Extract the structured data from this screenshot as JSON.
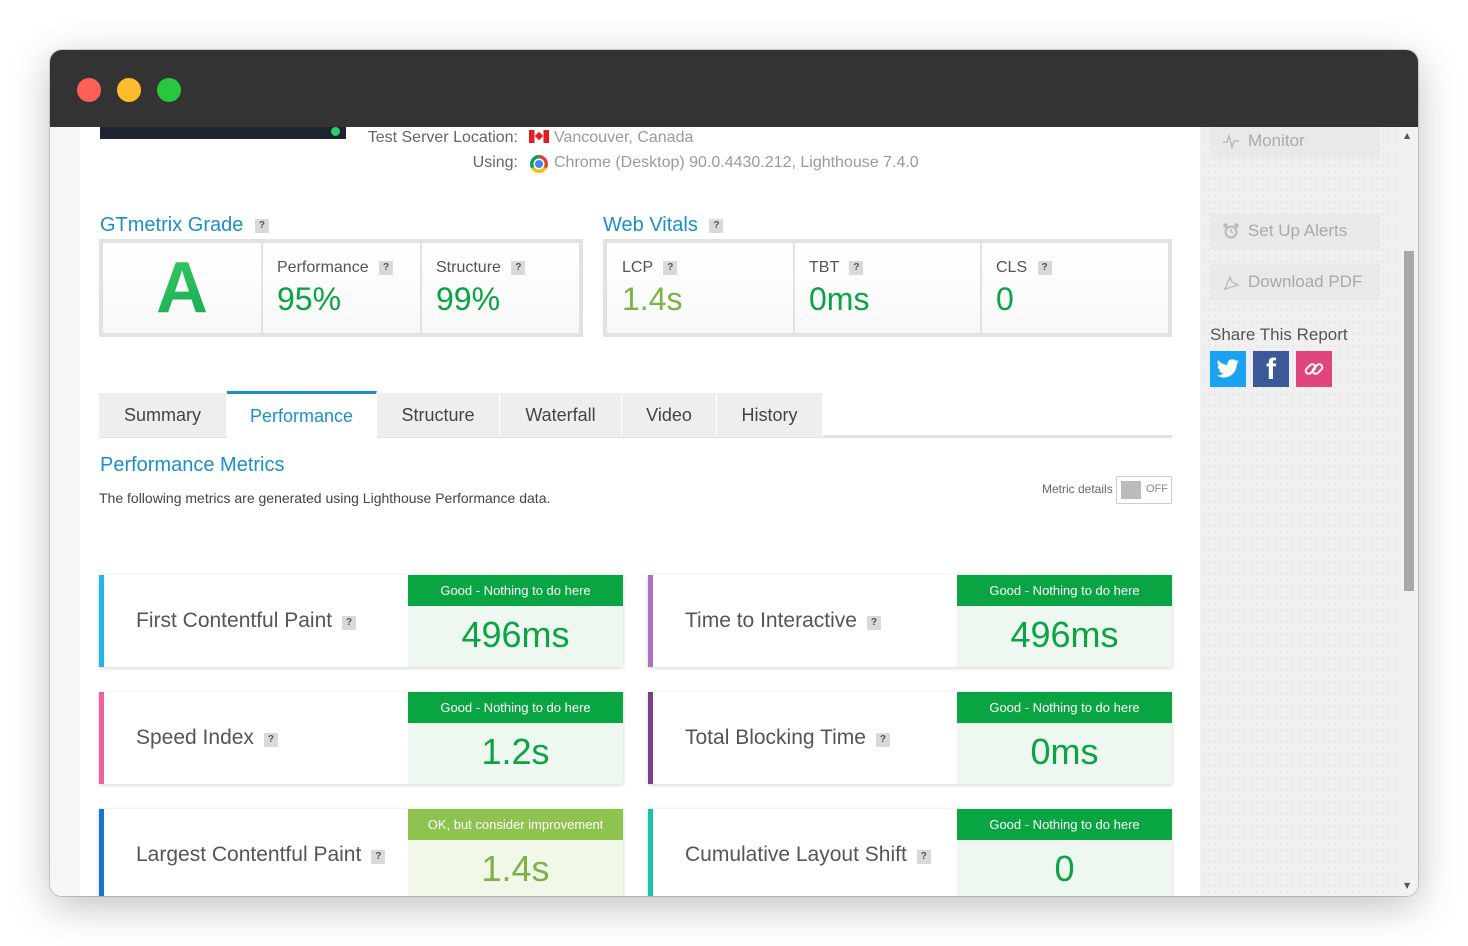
{
  "test_info": {
    "location_label": "Test Server Location:",
    "location_value": "Vancouver, Canada",
    "using_label": "Using:",
    "using_value": "Chrome (Desktop) 90.0.4430.212, Lighthouse 7.4.0"
  },
  "grade": {
    "title": "GTmetrix Grade",
    "letter": "A",
    "performance_label": "Performance",
    "performance_value": "95%",
    "structure_label": "Structure",
    "structure_value": "99%"
  },
  "web_vitals": {
    "title": "Web Vitals",
    "lcp_label": "LCP",
    "lcp_value": "1.4s",
    "tbt_label": "TBT",
    "tbt_value": "0ms",
    "cls_label": "CLS",
    "cls_value": "0"
  },
  "tabs": [
    {
      "label": "Summary"
    },
    {
      "label": "Performance"
    },
    {
      "label": "Structure"
    },
    {
      "label": "Waterfall"
    },
    {
      "label": "Video"
    },
    {
      "label": "History"
    }
  ],
  "active_tab": "Performance",
  "metrics_section": {
    "title": "Performance Metrics",
    "description": "The following metrics are generated using Lighthouse Performance data.",
    "toggle_label": "Metric details",
    "toggle_state": "OFF"
  },
  "metrics": [
    {
      "name": "First Contentful Paint",
      "status": "Good - Nothing to do here",
      "value": "496ms",
      "bar_color": "#1fb6ea"
    },
    {
      "name": "Time to Interactive",
      "status": "Good - Nothing to do here",
      "value": "496ms",
      "bar_color": "#b06fc7"
    },
    {
      "name": "Speed Index",
      "status": "Good - Nothing to do here",
      "value": "1.2s",
      "bar_color": "#ee5fa0"
    },
    {
      "name": "Total Blocking Time",
      "status": "Good - Nothing to do here",
      "value": "0ms",
      "bar_color": "#7a3f86"
    },
    {
      "name": "Largest Contentful Paint",
      "status": "OK, but consider improvement",
      "value": "1.4s",
      "bar_color": "#1476d2"
    },
    {
      "name": "Cumulative Layout Shift",
      "status": "Good - Nothing to do here",
      "value": "0",
      "bar_color": "#17c4a8"
    }
  ],
  "colors": {
    "good_badge": "#0aa543",
    "good_bg": "#eef8f1",
    "good_text": "#0aa543",
    "ok_badge": "#8fc350",
    "ok_bg": "#f2f8e9",
    "ok_text": "#7cb342",
    "accent": "#1a8fc9"
  },
  "sidebar": {
    "monitor_label": "Monitor",
    "alerts_label": "Set Up Alerts",
    "pdf_label": "Download PDF",
    "share_title": "Share This Report",
    "share_icons": [
      "twitter-icon",
      "facebook-icon",
      "link-icon"
    ]
  }
}
